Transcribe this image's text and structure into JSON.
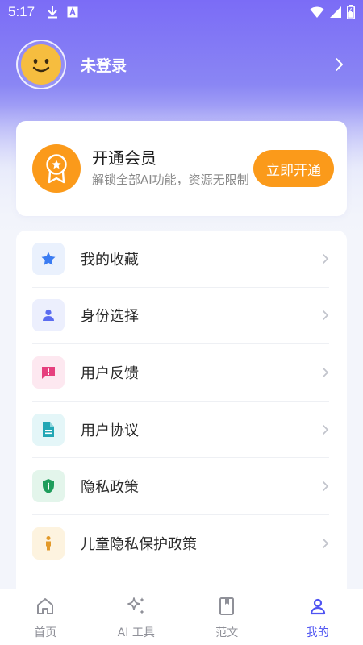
{
  "status_bar": {
    "time": "5:17",
    "icons": [
      "download-icon",
      "a-badge-icon",
      "wifi-icon",
      "signal-icon",
      "battery-icon"
    ]
  },
  "profile": {
    "name": "未登录",
    "avatar_icon": "smiley-face-icon"
  },
  "vip": {
    "title": "开通会员",
    "description": "解锁全部AI功能，资源无限制",
    "button_label": "立即开通",
    "accent_color": "#fb9a1a"
  },
  "menu": {
    "items": [
      {
        "label": "我的收藏",
        "icon": "star-icon",
        "color": "#3b7cf2",
        "bg": "#eaf1fd"
      },
      {
        "label": "身份选择",
        "icon": "person-icon",
        "color": "#5b6cf0",
        "bg": "#eceffd"
      },
      {
        "label": "用户反馈",
        "icon": "feedback-icon",
        "color": "#e6407e",
        "bg": "#fde8f0"
      },
      {
        "label": "用户协议",
        "icon": "document-icon",
        "color": "#23a7b5",
        "bg": "#e4f6f8"
      },
      {
        "label": "隐私政策",
        "icon": "shield-icon",
        "color": "#1f9d5c",
        "bg": "#e3f5eb"
      },
      {
        "label": "儿童隐私保护政策",
        "icon": "child-icon",
        "color": "#e39a2a",
        "bg": "#fdf3df"
      }
    ]
  },
  "bottom_nav": {
    "items": [
      {
        "label": "首页",
        "icon": "home-icon"
      },
      {
        "label": "AI 工具",
        "icon": "sparkle-icon"
      },
      {
        "label": "范文",
        "icon": "bookmark-book-icon"
      },
      {
        "label": "我的",
        "icon": "user-icon"
      }
    ],
    "active_index": 3,
    "active_color": "#4f54f2"
  }
}
